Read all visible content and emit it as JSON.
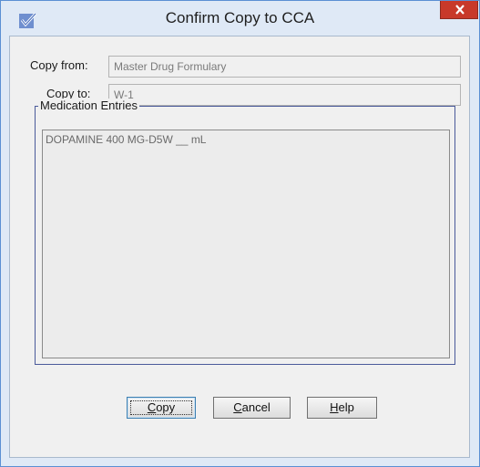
{
  "dialog": {
    "title": "Confirm Copy to CCA",
    "close_glyph": "x",
    "icon": "app-checkbox-icon"
  },
  "form": {
    "copy_from_label": "Copy from:",
    "copy_from_value": "Master Drug Formulary",
    "copy_to_label": "Copy to:",
    "copy_to_value": "W-1"
  },
  "medication_entries": {
    "title": "Medication Entries",
    "items": [
      "DOPAMINE 400 MG-D5W __ mL"
    ]
  },
  "buttons": {
    "copy": {
      "pre": "",
      "accel": "C",
      "post": "opy"
    },
    "cancel": {
      "pre": "",
      "accel": "C",
      "post": "ancel"
    },
    "help": {
      "pre": "",
      "accel": "H",
      "post": "elp"
    }
  },
  "colors": {
    "frame": "#dfe9f6",
    "close_button": "#c8392a",
    "client": "#f0f0f0"
  }
}
